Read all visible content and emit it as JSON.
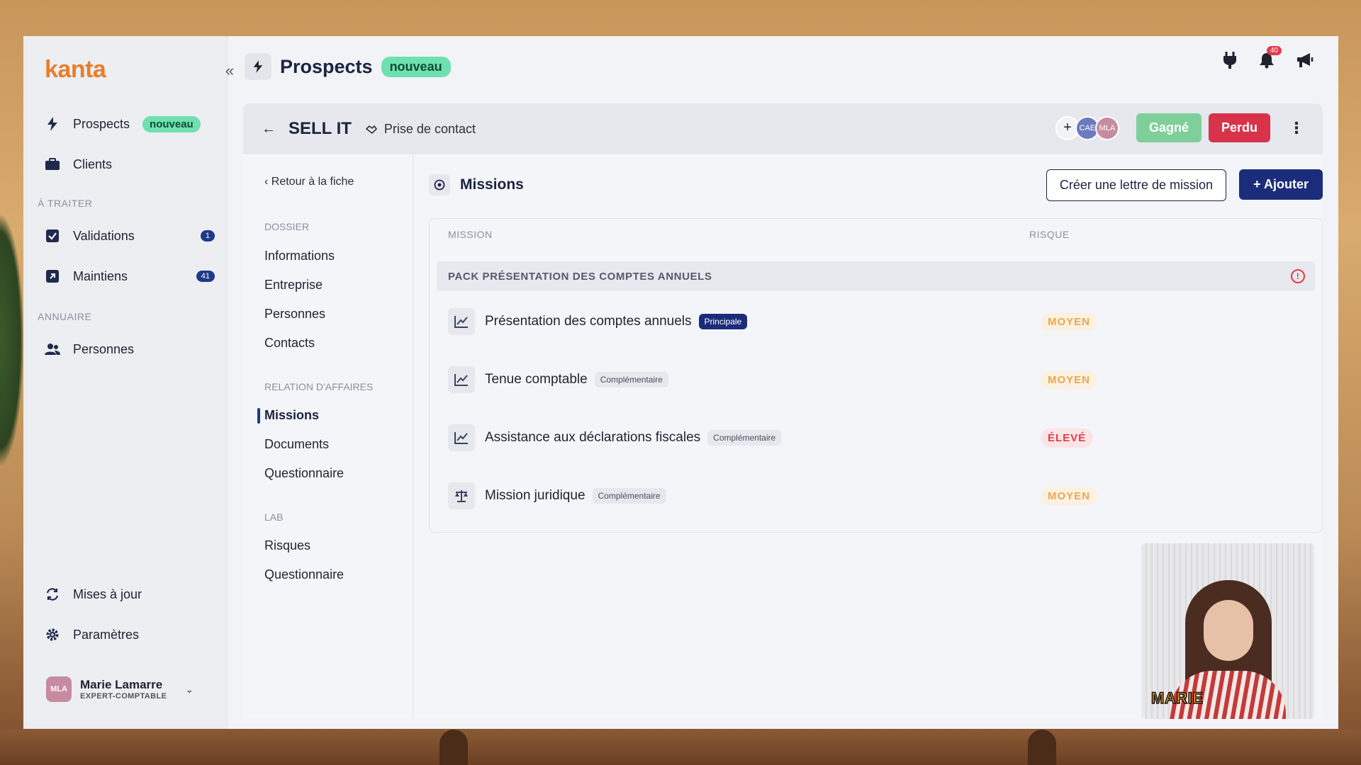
{
  "sidebar": {
    "logo": "kanta",
    "items": [
      {
        "label": "Prospects",
        "badge": "nouveau"
      },
      {
        "label": "Clients"
      }
    ],
    "section_todo": "À TRAITER",
    "todo_items": [
      {
        "label": "Validations",
        "count": "1"
      },
      {
        "label": "Maintiens",
        "count": "41"
      }
    ],
    "section_directory": "ANNUAIRE",
    "directory_items": [
      {
        "label": "Personnes"
      }
    ],
    "bottom_items": [
      {
        "label": "Mises à jour"
      },
      {
        "label": "Paramètres"
      }
    ],
    "user": {
      "initials": "MLA",
      "name": "Marie Lamarre",
      "role": "EXPERT-COMPTABLE"
    }
  },
  "topbar": {
    "title": "Prospects",
    "badge": "nouveau",
    "notification_count": "40"
  },
  "subbar": {
    "client_name": "SELL IT",
    "stage": "Prise de contact",
    "avatars": [
      "CAE",
      "MLA"
    ],
    "won_label": "Gagné",
    "lost_label": "Perdu"
  },
  "subnav": {
    "back": "Retour à la fiche",
    "section_dossier": "DOSSIER",
    "dossier": [
      "Informations",
      "Entreprise",
      "Personnes",
      "Contacts"
    ],
    "section_relation": "RELATION D'AFFAIRES",
    "relation": [
      "Missions",
      "Documents",
      "Questionnaire"
    ],
    "section_lab": "LAB",
    "lab": [
      "Risques",
      "Questionnaire"
    ]
  },
  "panel": {
    "title": "Missions",
    "create_letter": "Créer une lettre de mission",
    "add": "+ Ajouter",
    "col_mission": "MISSION",
    "col_risk": "RISQUE",
    "group": "PACK PRÉSENTATION DES COMPTES ANNUELS",
    "missions": [
      {
        "name": "Présentation des comptes annuels",
        "tag": "Principale",
        "risk": "MOYEN"
      },
      {
        "name": "Tenue comptable",
        "tag": "Complémentaire",
        "risk": "MOYEN"
      },
      {
        "name": "Assistance aux déclarations fiscales",
        "tag": "Complémentaire",
        "risk": "ÉLEVÉ"
      },
      {
        "name": "Mission juridique",
        "tag": "Complémentaire",
        "risk": "MOYEN"
      }
    ]
  },
  "video": {
    "caption": "MARIE"
  },
  "colors": {
    "accent": "#1b2d7a",
    "logo": "#e87d2c",
    "won": "#7fcf9a",
    "lost": "#d8334a",
    "badge_new": "#6fe0b0"
  }
}
